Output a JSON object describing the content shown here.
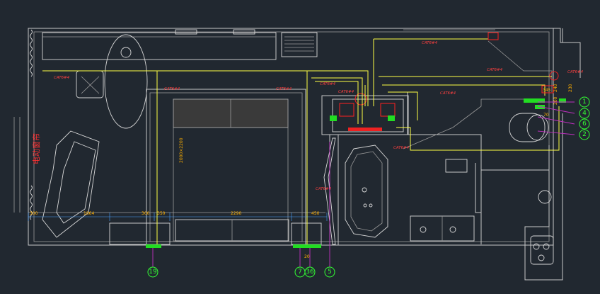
{
  "cable_labels": {
    "main_bath": "CAT6#4",
    "left_wall": "CAT6#4",
    "bed_left": "CAT6#4",
    "bed_right": "CAT6#4",
    "panel_top": "CAT6#4",
    "right_upper": "CAT6#4",
    "right_mid": "CAT6#4",
    "right_low": "CAT6#4",
    "bath_drop": "CAT6#4",
    "tv_drop": "CAT6#4",
    "entry": "CAT6#4"
  },
  "dimensions": {
    "d300_left": "300",
    "d1864": "1864",
    "d300_mid": "300",
    "d350": "350",
    "d2290": "2290",
    "d450": "450",
    "d20": "20",
    "d345": "345",
    "d240": "240",
    "d230": "230",
    "d200": "200",
    "d70": "70",
    "bed_vertical": "2000×2200"
  },
  "callouts": [
    "19",
    "7",
    "36",
    "5",
    "1",
    "4",
    "6",
    "2"
  ],
  "note_vertical": "电动窗帘",
  "colors": {
    "background": "#212830",
    "wall": "#c8c8c8",
    "cable": "#ffff44",
    "label": "#ff4040",
    "callout": "#33ff33",
    "leader": "#c030c0",
    "dimension": "#ffb000"
  }
}
